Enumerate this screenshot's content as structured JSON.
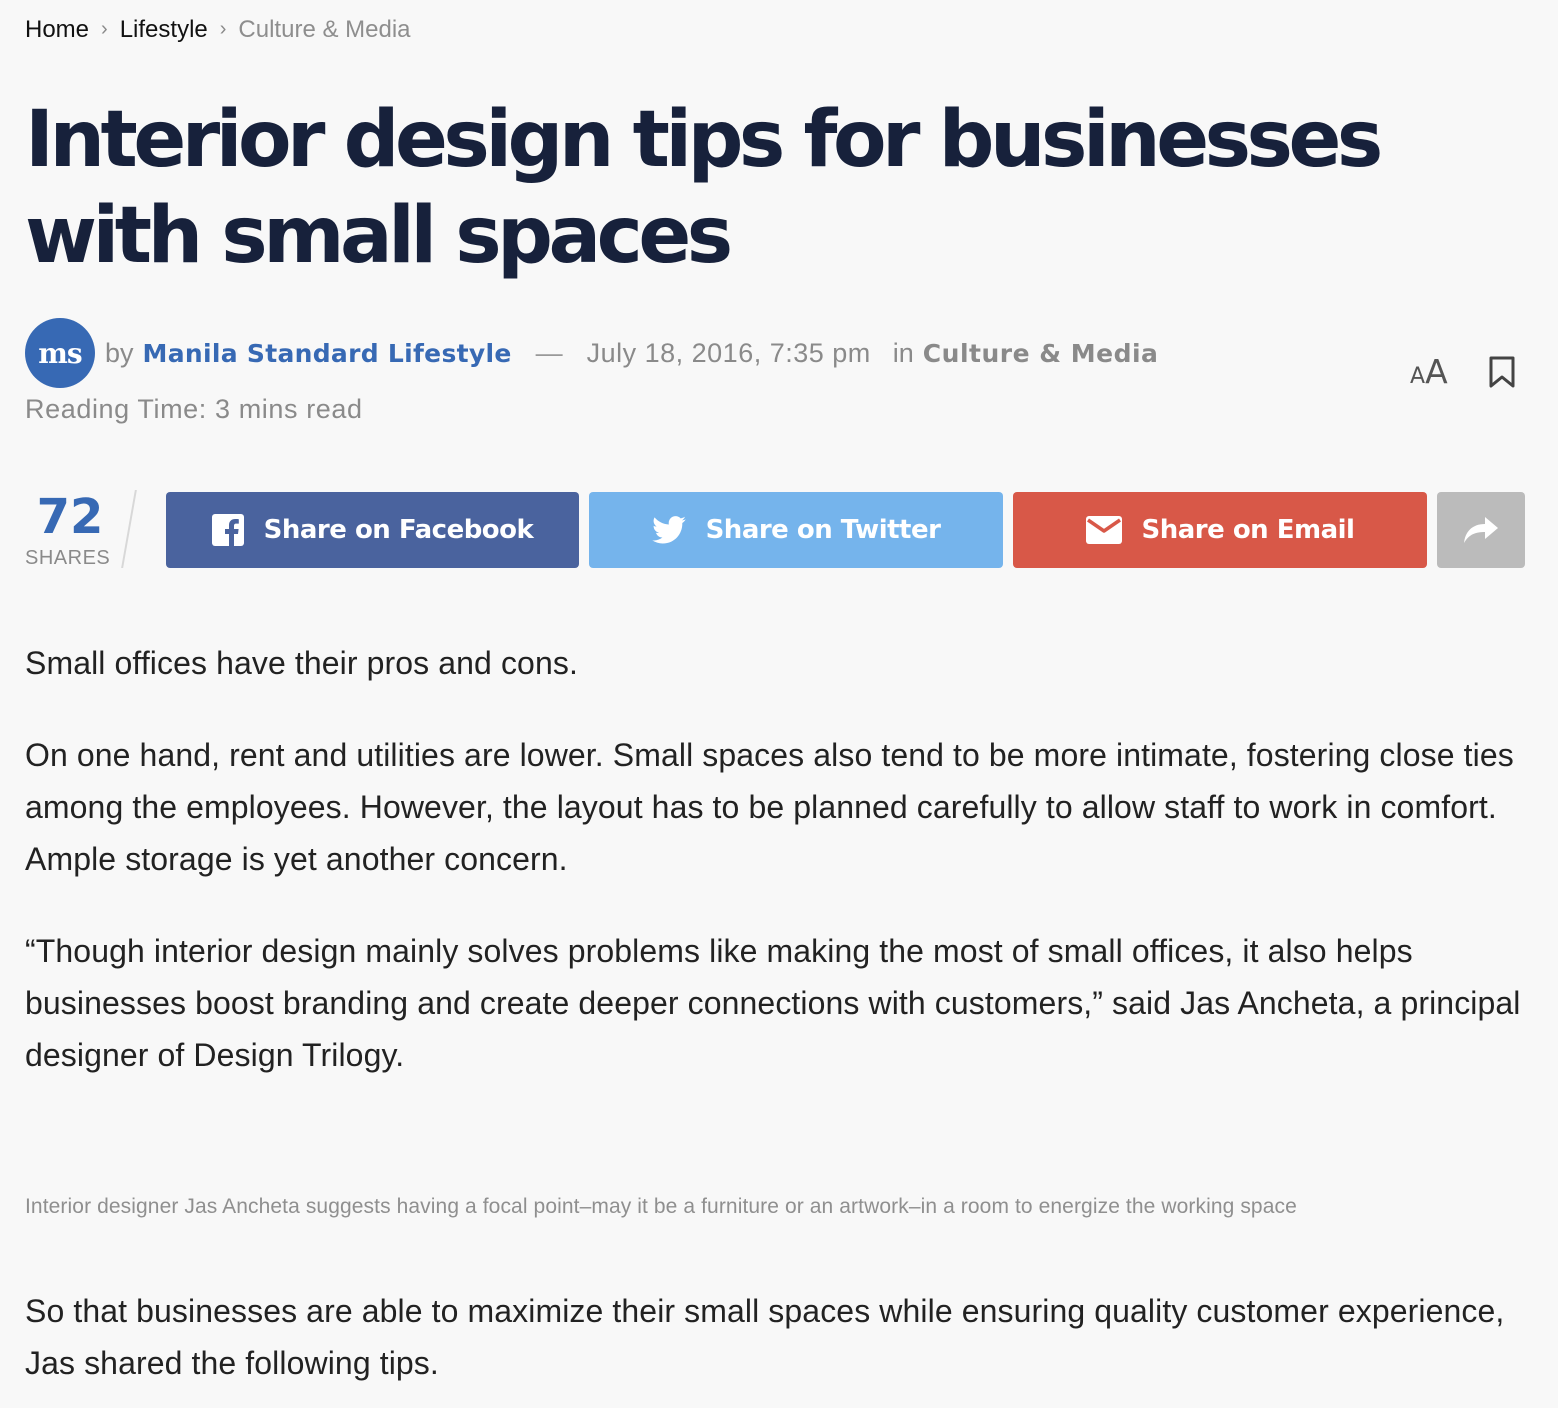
{
  "breadcrumb": {
    "items": [
      "Home",
      "Lifestyle"
    ],
    "current": "Culture & Media"
  },
  "article": {
    "title": "Interior design tips for businesses with small spaces",
    "author_initials": "ms",
    "by_label": "by",
    "author": "Manila Standard Lifestyle",
    "dash": "—",
    "date": "July 18, 2016, 7:35 pm",
    "in_label": "in",
    "category": "Culture & Media",
    "reading_time": "Reading Time: 3 mins read",
    "paragraphs": [
      "Small offices have their pros and cons.",
      "On one hand, rent and utilities are lower. Small spaces also tend to be more intimate, fostering close ties among the employees. However, the layout has to be planned carefully to allow staff to work in comfort. Ample storage is yet another concern.",
      "“Though interior design mainly solves problems like making the most of small offices, it also helps businesses boost branding and create deeper connections with customers,” said Jas Ancheta, a principal designer of Design Trilogy.",
      "So that businesses are able to maximize their small spaces while ensuring quality customer experience, Jas shared the following tips."
    ],
    "caption": "Interior designer Jas Ancheta suggests having a focal point–may it be a furniture or an artwork–in a room to energize the working space"
  },
  "tools": {
    "font_small": "A",
    "font_big": "A",
    "bookmark_icon": "bookmark-icon"
  },
  "share": {
    "count": "72",
    "count_label": "SHARES",
    "facebook_label": "Share on Facebook",
    "twitter_label": "Share on Twitter",
    "email_label": "Share on Email",
    "icons": [
      "facebook-icon",
      "twitter-icon",
      "email-icon",
      "share-arrow-icon"
    ]
  },
  "colors": {
    "title": "#17213b",
    "accent": "#3769b4",
    "facebook": "#4a639e",
    "twitter": "#75b4ec",
    "email": "#d85848",
    "more": "#bbbbbb"
  }
}
